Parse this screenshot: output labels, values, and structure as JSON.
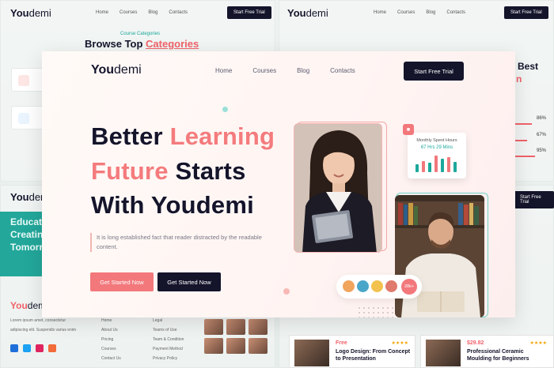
{
  "brand": {
    "bold": "You",
    "light": "demi"
  },
  "nav": [
    "Home",
    "Courses",
    "Blog",
    "Contacts"
  ],
  "cta_top": "Start Free Trial",
  "hero": {
    "line1_a": "Better ",
    "line1_b": "Learning",
    "line2_a": "Future",
    "line2_b": " Starts",
    "line3": "With Youdemi",
    "description": "It is long established fact that reader distracted by the readable content.",
    "btn_primary": "Get Started Now",
    "btn_secondary": "Get Started Now"
  },
  "stat_card": {
    "label": "Monthly Spent Hours",
    "value": "67 Hrs 29 Mins",
    "bars": [
      0.45,
      0.65,
      0.55,
      0.95,
      0.75,
      0.85,
      0.6
    ],
    "bar_colors": [
      "#1da89b",
      "#f2787c",
      "#1da89b",
      "#f2787c",
      "#1da89b",
      "#f2787c",
      "#1da89b"
    ]
  },
  "learners_badge": "28k+",
  "background": {
    "nav": [
      "Home",
      "Courses",
      "Blog",
      "Contacts"
    ],
    "cta": "Start Free Trial",
    "categories_sub": "Course Categories",
    "categories_title_a": "Browse Top ",
    "categories_title_b": "Categories",
    "teal_lines": [
      "Educat",
      "Creatin",
      "Tomorr"
    ],
    "best": "Best",
    "best2": "n",
    "percents": [
      "86%",
      "67%",
      "95%"
    ],
    "footer_about": "Lorem ipsum amet, consectetur adipiscing elit. Suspendis varius enim",
    "footer_col1": [
      "Home",
      "About Us",
      "Pricing",
      "Courses",
      "Contact Us"
    ],
    "footer_col2": [
      "Legal",
      "Teams of Use",
      "Team & Condition",
      "Payment Method",
      "Privacy Policy"
    ],
    "course1": {
      "price": "Free",
      "title": "Logo Design: From Concept to Presentation",
      "stars": "★★★★"
    },
    "course2": {
      "price": "$29.82",
      "title": "Professional Ceramic Moulding for Beginners",
      "stars": "★★★★"
    }
  }
}
